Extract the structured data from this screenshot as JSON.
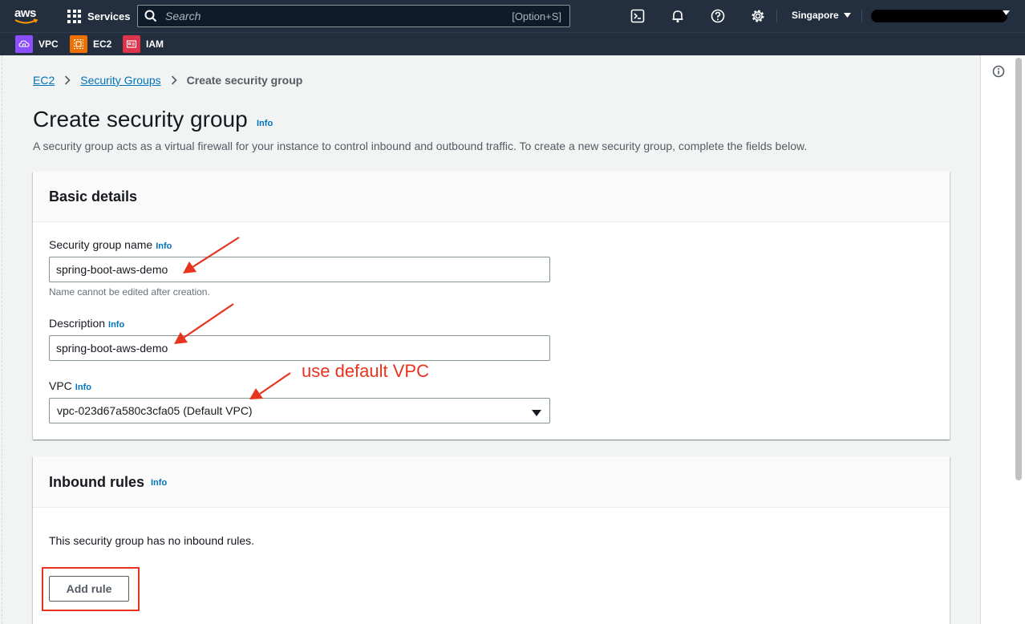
{
  "topnav": {
    "logo": "aws",
    "services_label": "Services",
    "search_placeholder": "Search",
    "search_shortcut": "[Option+S]",
    "region_label": "Singapore",
    "icons": [
      "cloudshell-icon",
      "bell-icon",
      "help-icon",
      "gear-icon"
    ]
  },
  "favorites": [
    {
      "label": "VPC",
      "color": "#8c4fff",
      "icon": "vpc-icon"
    },
    {
      "label": "EC2",
      "color": "#ed7100",
      "icon": "ec2-icon"
    },
    {
      "label": "IAM",
      "color": "#dd344c",
      "icon": "iam-icon"
    }
  ],
  "breadcrumb": {
    "items": [
      "EC2",
      "Security Groups"
    ],
    "current": "Create security group"
  },
  "page": {
    "title": "Create security group",
    "info": "Info",
    "description": "A security group acts as a virtual firewall for your instance to control inbound and outbound traffic. To create a new security group, complete the fields below."
  },
  "basic_details": {
    "title": "Basic details",
    "name_label": "Security group name",
    "name_info": "Info",
    "name_value": "spring-boot-aws-demo",
    "name_hint": "Name cannot be edited after creation.",
    "desc_label": "Description",
    "desc_info": "Info",
    "desc_value": "spring-boot-aws-demo",
    "vpc_label": "VPC",
    "vpc_info": "Info",
    "vpc_value": "vpc-023d67a580c3cfa05 (Default VPC)"
  },
  "inbound_rules": {
    "title": "Inbound rules",
    "info": "Info",
    "empty_text": "This security group has no inbound rules.",
    "add_rule_label": "Add rule"
  },
  "annotation": {
    "text": "use default VPC",
    "color": "#e8331f"
  },
  "colors": {
    "nav_bg": "#232f3e",
    "link": "#0073bb"
  }
}
